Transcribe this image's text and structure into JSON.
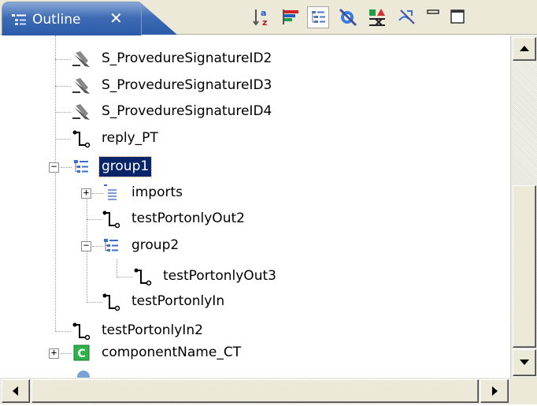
{
  "view": {
    "tab_label": "Outline",
    "close_glyph": "✕",
    "toolbar": [
      {
        "name": "sort-alphabetical-icon",
        "pressed": false
      },
      {
        "name": "filter-color-bars-icon",
        "pressed": false
      },
      {
        "name": "hierarchy-tree-icon",
        "pressed": true
      },
      {
        "name": "hide-fields-icon",
        "pressed": false
      },
      {
        "name": "show-types-icon",
        "pressed": false
      },
      {
        "name": "hide-nonpublic-icon",
        "pressed": false
      },
      {
        "name": "minimize-icon",
        "pressed": false
      },
      {
        "name": "maximize-icon",
        "pressed": false
      }
    ]
  },
  "tree": {
    "items": [
      {
        "label": "S_ProvedureSignatureID2",
        "icon": "signature-pen-icon"
      },
      {
        "label": "S_ProvedureSignatureID3",
        "icon": "signature-pen-icon"
      },
      {
        "label": "S_ProvedureSignatureID4",
        "icon": "signature-pen-icon"
      },
      {
        "label": "reply_PT",
        "icon": "port-type-icon"
      },
      {
        "label": "group1",
        "icon": "group-icon",
        "expanded": true,
        "selected": true
      },
      {
        "label": "imports",
        "icon": "imports-icon",
        "expanded": false
      },
      {
        "label": "testPortonlyOut2",
        "icon": "port-type-icon"
      },
      {
        "label": "group2",
        "icon": "group-icon",
        "expanded": true
      },
      {
        "label": "testPortonlyOut3",
        "icon": "port-type-icon"
      },
      {
        "label": "testPortonlyIn",
        "icon": "port-type-icon"
      },
      {
        "label": "testPortonlyIn2",
        "icon": "port-type-icon"
      },
      {
        "label": "componentName_CT",
        "icon": "component-icon",
        "expanded": false
      },
      {
        "label": "",
        "icon": "partial-row-icon"
      }
    ]
  },
  "scroll": {
    "vertical_position": 0.55,
    "horizontal_position": 0.0
  }
}
